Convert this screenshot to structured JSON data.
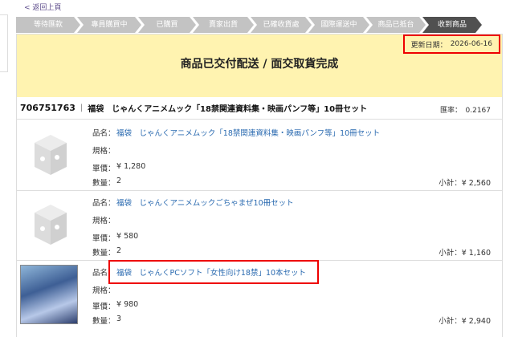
{
  "nav": {
    "back_label": "< 返回上頁"
  },
  "steps": [
    "等待匯款",
    "專員購買中",
    "已購買",
    "賣家出貨",
    "已確收貨處",
    "國際運送中",
    "商品已抵台",
    "收到商品"
  ],
  "update": {
    "label": "更新日期：",
    "date": "2026-06-16"
  },
  "banner": {
    "title": "商品已交付配送 / 面交取貨完成"
  },
  "order": {
    "id": "706751763",
    "title": "福袋　じゃんくアニメムック「18禁関連資料集・映画パンフ等」10冊セット",
    "rate_label": "匯率：",
    "rate_value": "0.2167"
  },
  "labels": {
    "name": "品名：",
    "spec": "規格：",
    "price": "單價：",
    "qty": "數量：",
    "subtotal": "小計："
  },
  "items": [
    {
      "name": "福袋　じゃんくアニメムック「18禁関連資料集・映画パンフ等」10冊セット",
      "spec": "",
      "price": "¥ 1,280",
      "qty": "2",
      "subtotal": "¥ 2,560",
      "image": "placeholder-icon"
    },
    {
      "name": "福袋　じゃんくアニメムックごちゃまぜ10冊セット",
      "spec": "",
      "price": "¥ 580",
      "qty": "2",
      "subtotal": "¥ 1,160",
      "image": "placeholder-icon"
    },
    {
      "name": "福袋　じゃんくPCソフト「女性向け18禁」10本セット",
      "spec": "",
      "price": "¥ 980",
      "qty": "3",
      "subtotal": "¥ 2,940",
      "image": "product-cover"
    }
  ]
}
